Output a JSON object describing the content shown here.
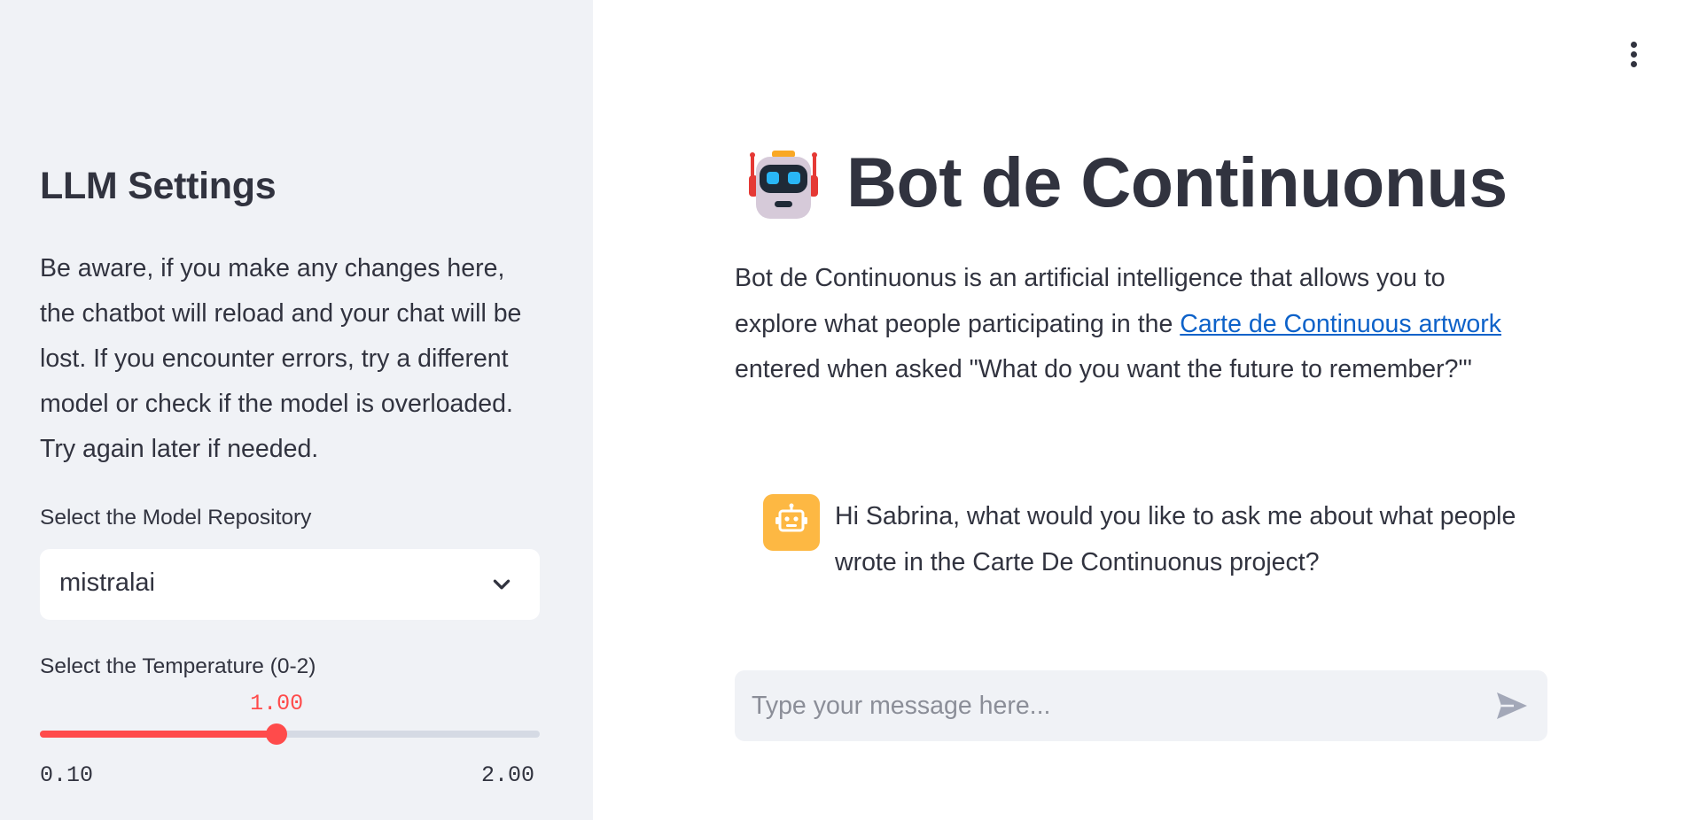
{
  "sidebar": {
    "title": "LLM Settings",
    "warning": "Be aware, if you make any changes here, the chatbot will reload and your chat will be lost. If you encounter errors, try a different model or check if the model is overloaded. Try again later if needed.",
    "model_select": {
      "label": "Select the Model Repository",
      "value": "mistralai"
    },
    "temperature": {
      "label": "Select the Temperature (0-2)",
      "value_text": "1.00",
      "value": 1.0,
      "min": 0.1,
      "max": 2.0,
      "min_text": "0.10",
      "max_text": "2.00"
    }
  },
  "main": {
    "title": "Bot de Continuonus",
    "intro": {
      "part1": "Bot de Continuonus is an artificial intelligence that allows you to explore what people participating in the ",
      "link_text": "Carte de Continuous artwork",
      "part2": " entered when asked \"What do you want the future to remember?\"'"
    },
    "message": "Hi Sabrina, what would you like to ask me about what people wrote in the Carte De Continuonus project?",
    "chat_input": {
      "placeholder": "Type your message here..."
    }
  },
  "colors": {
    "sidebar_bg": "#f0f2f6",
    "accent": "#ff4b4b",
    "link": "#0d62c9",
    "avatar_bg": "#fdb843",
    "text": "#31333f"
  },
  "icons": {
    "menu": "kebab-menu-icon",
    "title_emoji": "robot-emoji-icon",
    "avatar": "robot-avatar-icon",
    "chevron": "chevron-down-icon",
    "send": "send-icon"
  }
}
